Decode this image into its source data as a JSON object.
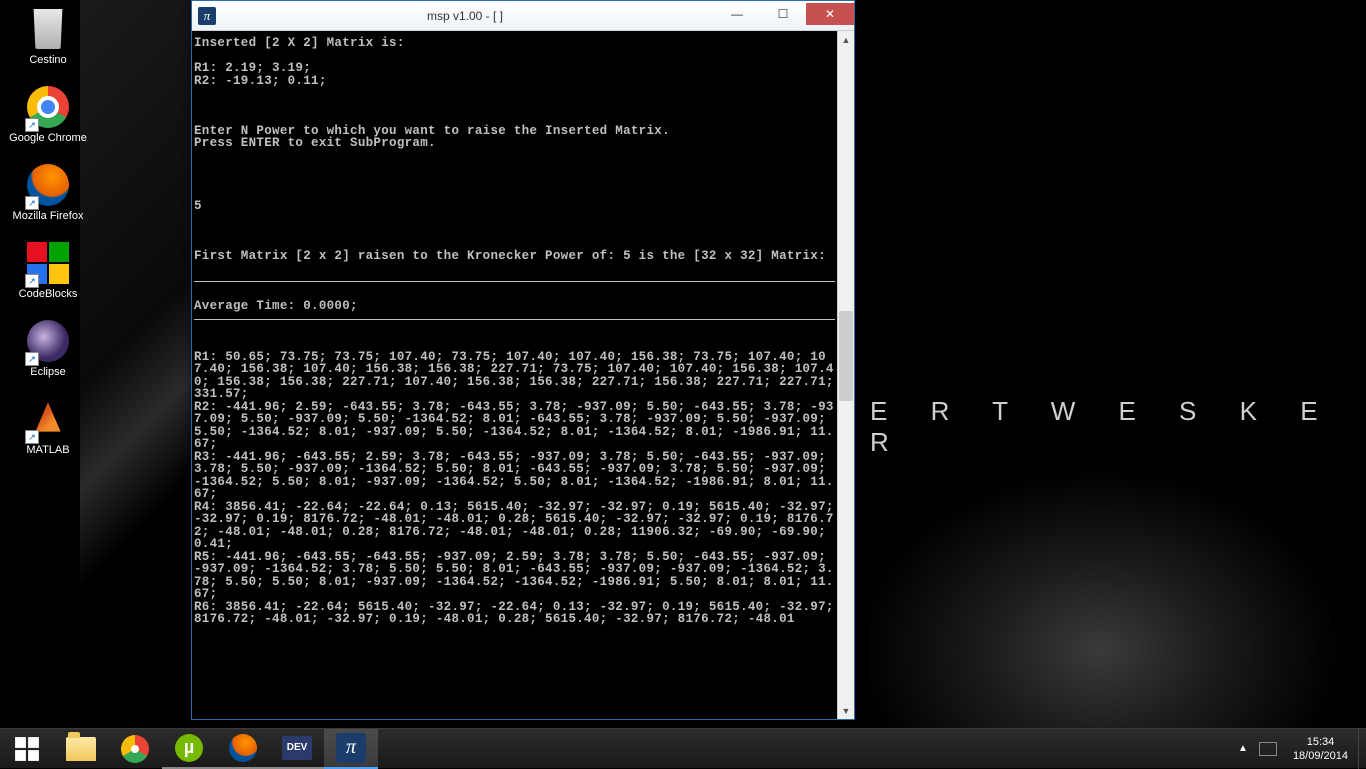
{
  "wallpaper_text": "E R T   W E S K E R",
  "desktop": [
    {
      "id": "bin",
      "label": "Cestino",
      "shortcut": false
    },
    {
      "id": "chrome",
      "label": "Google Chrome",
      "shortcut": true
    },
    {
      "id": "firefox",
      "label": "Mozilla Firefox",
      "shortcut": true
    },
    {
      "id": "codeblocks",
      "label": "CodeBlocks",
      "shortcut": true
    },
    {
      "id": "eclipse",
      "label": "Eclipse",
      "shortcut": true
    },
    {
      "id": "matlab",
      "label": "MATLAB",
      "shortcut": true
    }
  ],
  "window": {
    "title": "msp v1.00 - [  ]",
    "min": "—",
    "max": "☐",
    "close": "✕"
  },
  "console": {
    "header": "Inserted [2 X 2] Matrix is:",
    "r1": "R1: 2.19; 3.19;",
    "r2": "R2: -19.13; 0.11;",
    "prompt1": "Enter N Power to which you want to raise the Inserted Matrix.",
    "prompt2": "Press ENTER to exit SubProgram.",
    "input": "5",
    "result_header": "First Matrix [2 x 2] raisen to the Kronecker Power of: 5 is the [32 x 32] Matrix:",
    "avg": "Average Time: 0.0000;",
    "out_r1": "R1: 50.65; 73.75; 73.75; 107.40; 73.75; 107.40; 107.40; 156.38; 73.75; 107.40; 107.40; 156.38; 107.40; 156.38; 156.38; 227.71; 73.75; 107.40; 107.40; 156.38; 107.40; 156.38; 156.38; 227.71; 107.40; 156.38; 156.38; 227.71; 156.38; 227.71; 227.71; 331.57;",
    "out_r2": "R2: -441.96; 2.59; -643.55; 3.78; -643.55; 3.78; -937.09; 5.50; -643.55; 3.78; -937.09; 5.50; -937.09; 5.50; -1364.52; 8.01; -643.55; 3.78; -937.09; 5.50; -937.09; 5.50; -1364.52; 8.01; -937.09; 5.50; -1364.52; 8.01; -1364.52; 8.01; -1986.91; 11.67;",
    "out_r3": "R3: -441.96; -643.55; 2.59; 3.78; -643.55; -937.09; 3.78; 5.50; -643.55; -937.09; 3.78; 5.50; -937.09; -1364.52; 5.50; 8.01; -643.55; -937.09; 3.78; 5.50; -937.09; -1364.52; 5.50; 8.01; -937.09; -1364.52; 5.50; 8.01; -1364.52; -1986.91; 8.01; 11.67;",
    "out_r4": "R4: 3856.41; -22.64; -22.64; 0.13; 5615.40; -32.97; -32.97; 0.19; 5615.40; -32.97; -32.97; 0.19; 8176.72; -48.01; -48.01; 0.28; 5615.40; -32.97; -32.97; 0.19; 8176.72; -48.01; -48.01; 0.28; 8176.72; -48.01; -48.01; 0.28; 11906.32; -69.90; -69.90; 0.41;",
    "out_r5": "R5: -441.96; -643.55; -643.55; -937.09; 2.59; 3.78; 3.78; 5.50; -643.55; -937.09; -937.09; -1364.52; 3.78; 5.50; 5.50; 8.01; -643.55; -937.09; -937.09; -1364.52; 3.78; 5.50; 5.50; 8.01; -937.09; -1364.52; -1364.52; -1986.91; 5.50; 8.01; 8.01; 11.67;",
    "out_r6": "R6: 3856.41; -22.64; 5615.40; -32.97; -22.64; 0.13; -32.97; 0.19; 5615.40; -32.97; 8176.72; -48.01; -32.97; 0.19; -48.01; 0.28; 5615.40; -32.97; 8176.72; -48.01"
  },
  "taskbar": {
    "items": [
      "start",
      "explorer",
      "chrome",
      "utorrent",
      "firefox",
      "devcpp",
      "pi"
    ],
    "time": "15:34",
    "date": "18/09/2014"
  },
  "chart_data": {
    "type": "table",
    "title": "Inserted [2 X 2] Matrix",
    "matrix_input": [
      [
        2.19,
        3.19
      ],
      [
        -19.13,
        0.11
      ]
    ],
    "kronecker_power": 5,
    "result_dims": [
      32,
      32
    ],
    "average_time": 0.0,
    "output_rows_shown": {
      "R1": [
        50.65,
        73.75,
        73.75,
        107.4,
        73.75,
        107.4,
        107.4,
        156.38,
        73.75,
        107.4,
        107.4,
        156.38,
        107.4,
        156.38,
        156.38,
        227.71,
        73.75,
        107.4,
        107.4,
        156.38,
        107.4,
        156.38,
        156.38,
        227.71,
        107.4,
        156.38,
        156.38,
        227.71,
        156.38,
        227.71,
        227.71,
        331.57
      ],
      "R2": [
        -441.96,
        2.59,
        -643.55,
        3.78,
        -643.55,
        3.78,
        -937.09,
        5.5,
        -643.55,
        3.78,
        -937.09,
        5.5,
        -937.09,
        5.5,
        -1364.52,
        8.01,
        -643.55,
        3.78,
        -937.09,
        5.5,
        -937.09,
        5.5,
        -1364.52,
        8.01,
        -937.09,
        5.5,
        -1364.52,
        8.01,
        -1364.52,
        8.01,
        -1986.91,
        11.67
      ],
      "R3": [
        -441.96,
        -643.55,
        2.59,
        3.78,
        -643.55,
        -937.09,
        3.78,
        5.5,
        -643.55,
        -937.09,
        3.78,
        5.5,
        -937.09,
        -1364.52,
        5.5,
        8.01,
        -643.55,
        -937.09,
        3.78,
        5.5,
        -937.09,
        -1364.52,
        5.5,
        8.01,
        -937.09,
        -1364.52,
        5.5,
        8.01,
        -1364.52,
        -1986.91,
        8.01,
        11.67
      ],
      "R4": [
        3856.41,
        -22.64,
        -22.64,
        0.13,
        5615.4,
        -32.97,
        -32.97,
        0.19,
        5615.4,
        -32.97,
        -32.97,
        0.19,
        8176.72,
        -48.01,
        -48.01,
        0.28,
        5615.4,
        -32.97,
        -32.97,
        0.19,
        8176.72,
        -48.01,
        -48.01,
        0.28,
        8176.72,
        -48.01,
        -48.01,
        0.28,
        11906.32,
        -69.9,
        -69.9,
        0.41
      ],
      "R5": [
        -441.96,
        -643.55,
        -643.55,
        -937.09,
        2.59,
        3.78,
        3.78,
        5.5,
        -643.55,
        -937.09,
        -937.09,
        -1364.52,
        3.78,
        5.5,
        5.5,
        8.01,
        -643.55,
        -937.09,
        -937.09,
        -1364.52,
        3.78,
        5.5,
        5.5,
        8.01,
        -937.09,
        -1364.52,
        -1364.52,
        -1986.91,
        5.5,
        8.01,
        8.01,
        11.67
      ],
      "R6_partial": [
        3856.41,
        -22.64,
        5615.4,
        -32.97,
        -22.64,
        0.13,
        -32.97,
        0.19,
        5615.4,
        -32.97,
        8176.72,
        -48.01,
        -32.97,
        0.19,
        -48.01,
        0.28,
        5615.4,
        -32.97,
        8176.72,
        -48.01
      ]
    }
  }
}
